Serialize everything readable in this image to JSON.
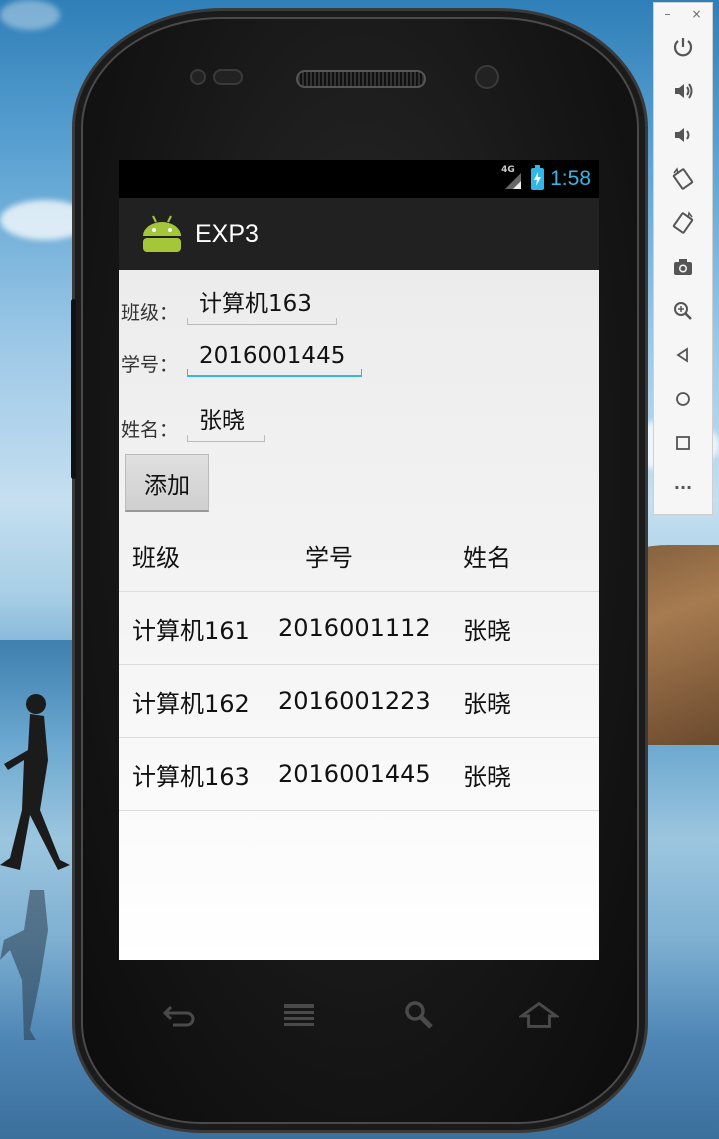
{
  "emulator_panel": {
    "minimize": "–",
    "close": "×",
    "tools": [
      "power-icon",
      "volume-up-icon",
      "volume-down-icon",
      "rotate-left-icon",
      "rotate-right-icon",
      "camera-icon",
      "zoom-icon",
      "back-icon",
      "home-icon",
      "overview-icon",
      "more-icon"
    ],
    "more_label": "···"
  },
  "status_bar": {
    "network": "4G",
    "time": "1:58",
    "accent_color": "#33b5e5"
  },
  "app": {
    "title": "EXP3",
    "icon": "android-robot-icon"
  },
  "form": {
    "class_label": "班级：",
    "class_value": "计算机163",
    "id_label": "学号：",
    "id_value": "2016001445",
    "name_label": "姓名：",
    "name_value": "张晓",
    "add_button": "添加"
  },
  "table": {
    "headers": [
      "班级",
      "学号",
      "姓名"
    ],
    "rows": [
      [
        "计算机161",
        "2016001112",
        "张晓"
      ],
      [
        "计算机162",
        "2016001223",
        "张晓"
      ],
      [
        "计算机163",
        "2016001445",
        "张晓"
      ]
    ]
  },
  "navbar": [
    "back-icon",
    "menu-icon",
    "search-icon",
    "home-icon"
  ]
}
